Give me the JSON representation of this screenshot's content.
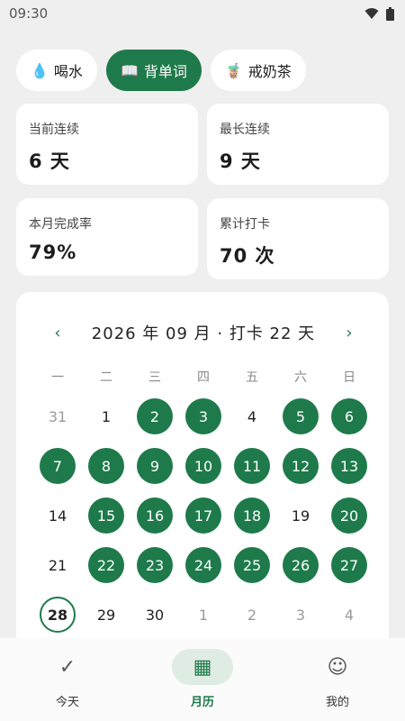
{
  "status_bar": {
    "time": "09:30"
  },
  "habit_tabs": [
    {
      "emoji": "💧",
      "label": "喝水",
      "active": false
    },
    {
      "emoji": "📖",
      "label": "背单词",
      "active": true
    },
    {
      "emoji": "🧋",
      "label": "戒奶茶",
      "active": false
    }
  ],
  "stats": {
    "current_streak": {
      "label": "当前连续",
      "value": "6 天"
    },
    "longest_streak": {
      "label": "最长连续",
      "value": "9 天"
    },
    "month_rate": {
      "label": "本月完成率",
      "value": "79%"
    },
    "total_checkins": {
      "label": "累计打卡",
      "value": "70 次"
    }
  },
  "calendar": {
    "prev": "‹",
    "next": "›",
    "title": "2026 年 09 月 · 打卡 22 天",
    "weekdays": [
      "一",
      "二",
      "三",
      "四",
      "五",
      "六",
      "日"
    ],
    "days": [
      {
        "label": "31",
        "muted": true,
        "checked": false
      },
      {
        "label": "1",
        "muted": false,
        "checked": false
      },
      {
        "label": "2",
        "muted": false,
        "checked": true
      },
      {
        "label": "3",
        "muted": false,
        "checked": true
      },
      {
        "label": "4",
        "muted": false,
        "checked": false
      },
      {
        "label": "5",
        "muted": false,
        "checked": true
      },
      {
        "label": "6",
        "muted": false,
        "checked": true
      },
      {
        "label": "7",
        "muted": false,
        "checked": true
      },
      {
        "label": "8",
        "muted": false,
        "checked": true
      },
      {
        "label": "9",
        "muted": false,
        "checked": true
      },
      {
        "label": "10",
        "muted": false,
        "checked": true
      },
      {
        "label": "11",
        "muted": false,
        "checked": true
      },
      {
        "label": "12",
        "muted": false,
        "checked": true
      },
      {
        "label": "13",
        "muted": false,
        "checked": true
      },
      {
        "label": "14",
        "muted": false,
        "checked": false
      },
      {
        "label": "15",
        "muted": false,
        "checked": true
      },
      {
        "label": "16",
        "muted": false,
        "checked": true
      },
      {
        "label": "17",
        "muted": false,
        "checked": true
      },
      {
        "label": "18",
        "muted": false,
        "checked": true
      },
      {
        "label": "19",
        "muted": false,
        "checked": false
      },
      {
        "label": "20",
        "muted": false,
        "checked": true
      },
      {
        "label": "21",
        "muted": false,
        "checked": false
      },
      {
        "label": "22",
        "muted": false,
        "checked": true
      },
      {
        "label": "23",
        "muted": false,
        "checked": true
      },
      {
        "label": "24",
        "muted": false,
        "checked": true
      },
      {
        "label": "25",
        "muted": false,
        "checked": true
      },
      {
        "label": "26",
        "muted": false,
        "checked": true
      },
      {
        "label": "27",
        "muted": false,
        "checked": true
      },
      {
        "label": "28",
        "muted": false,
        "checked": false,
        "today": true
      },
      {
        "label": "29",
        "muted": false,
        "checked": false
      },
      {
        "label": "30",
        "muted": false,
        "checked": false
      },
      {
        "label": "1",
        "muted": true,
        "checked": false
      },
      {
        "label": "2",
        "muted": true,
        "checked": false
      },
      {
        "label": "3",
        "muted": true,
        "checked": false
      },
      {
        "label": "4",
        "muted": true,
        "checked": false
      }
    ]
  },
  "bottom_nav": [
    {
      "icon": "✓",
      "icon_name": "check-icon",
      "label": "今天",
      "active": false
    },
    {
      "icon": "▦",
      "icon_name": "calendar-grid-icon",
      "label": "月历",
      "active": true
    },
    {
      "icon": "☺",
      "icon_name": "smile-icon",
      "label": "我的",
      "active": false
    }
  ],
  "colors": {
    "accent": "#1e7a4a",
    "background": "#efefef"
  }
}
